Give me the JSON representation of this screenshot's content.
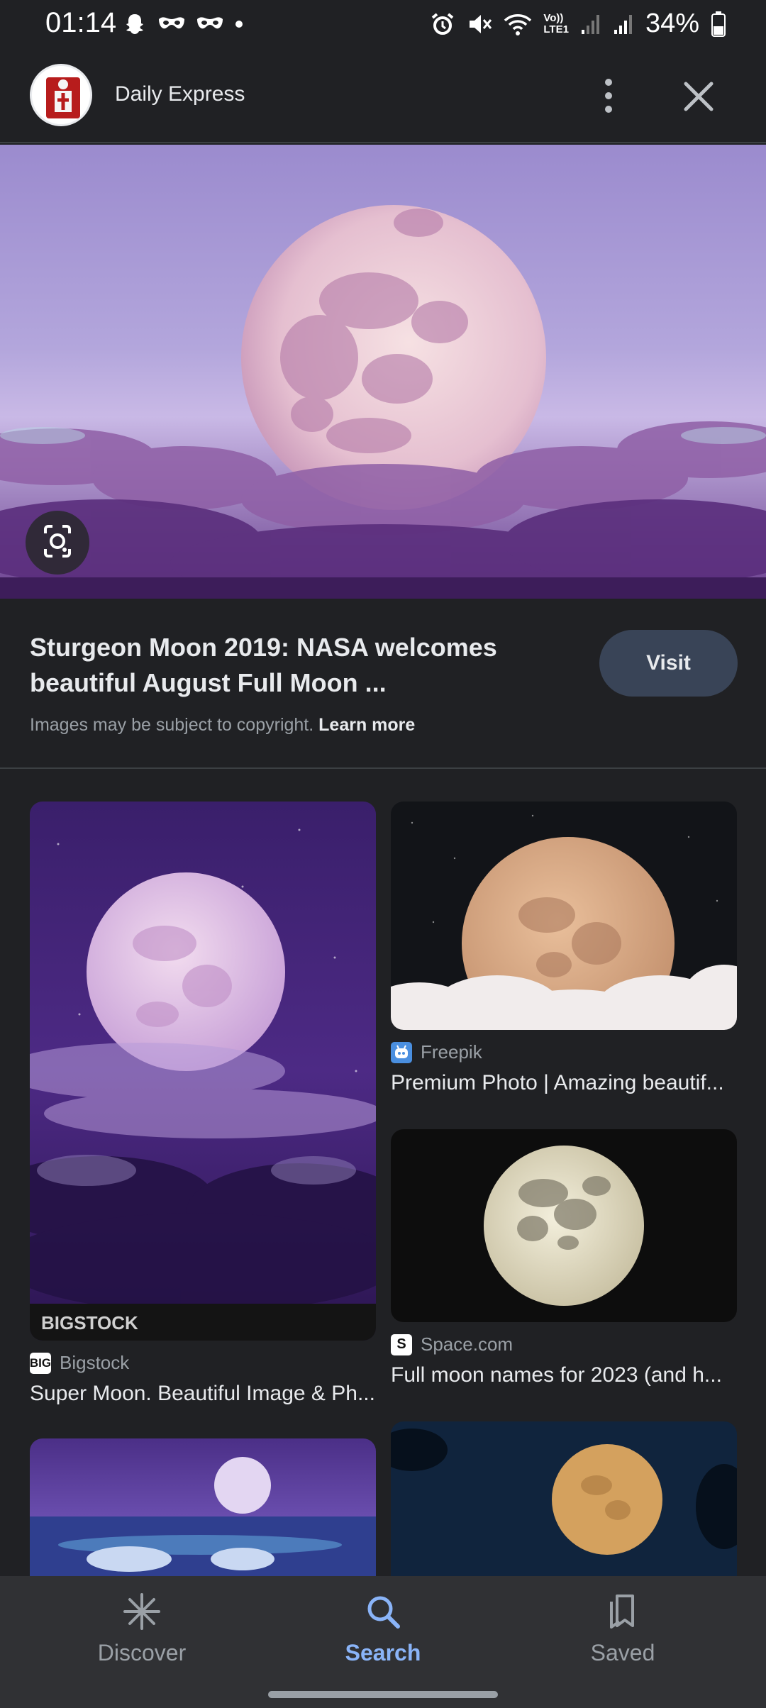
{
  "status_bar": {
    "time": "01:14",
    "battery_percent": "34%",
    "network_label_top": "Vo))",
    "network_label_bottom": "LTE1"
  },
  "header": {
    "site_name": "Daily Express"
  },
  "main_result": {
    "title": "Sturgeon Moon 2019: NASA welcomes beautiful August Full Moon ...",
    "visit_label": "Visit",
    "copyright_text": "Images may be subject to copyright.",
    "learn_more_label": "Learn more"
  },
  "results": [
    {
      "source": "Bigstock",
      "source_icon_text": "BIG",
      "caption": "Super Moon. Beautiful Image & Ph...",
      "watermark": "BIGSTOCK"
    },
    {
      "source": "Freepik",
      "caption": "Premium Photo | Amazing beautif..."
    },
    {
      "source": "Space.com",
      "source_icon_text": "S",
      "caption": "Full moon names for 2023 (and h..."
    }
  ],
  "bottom_nav": {
    "items": [
      {
        "label": "Discover",
        "icon": "sparkle-icon"
      },
      {
        "label": "Search",
        "icon": "search-icon"
      },
      {
        "label": "Saved",
        "icon": "bookmark-icon"
      }
    ],
    "active": "Search"
  },
  "colors": {
    "background": "#202124",
    "accent": "#8ab4f8",
    "visit_button": "#394457"
  }
}
